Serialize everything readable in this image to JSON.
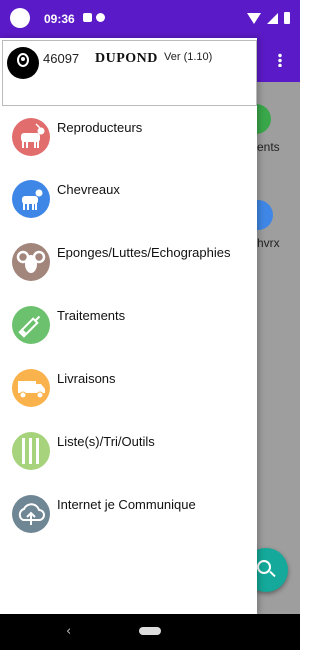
{
  "status_bar": {
    "time": "09:36"
  },
  "header": {
    "id": "46097",
    "name": "DUPOND",
    "version": "Ver (1.10)"
  },
  "menu": [
    {
      "label": "Reproducteurs",
      "icon": "goat-icon",
      "color": "#e26d6d"
    },
    {
      "label": "Chevreaux",
      "icon": "kid-goat-icon",
      "color": "#3f87e6"
    },
    {
      "label": "Eponges/Luttes/Echographies",
      "icon": "ram-head-icon",
      "color": "#a2857b"
    },
    {
      "label": "Traitements",
      "icon": "syringe-icon",
      "color": "#6cc16e"
    },
    {
      "label": "Livraisons",
      "icon": "truck-icon",
      "color": "#f9b24c"
    },
    {
      "label": "Liste(s)/Tri/Outils",
      "icon": "list-tools-icon",
      "color": "#a6d37b"
    },
    {
      "label": "Internet je Communique",
      "icon": "cloud-upload-icon",
      "color": "#6f8694"
    }
  ],
  "background": {
    "tiles": [
      {
        "label": "ents",
        "color": "#3aa84a"
      },
      {
        "label": "hvrx",
        "color": "#3f87e6"
      }
    ]
  }
}
